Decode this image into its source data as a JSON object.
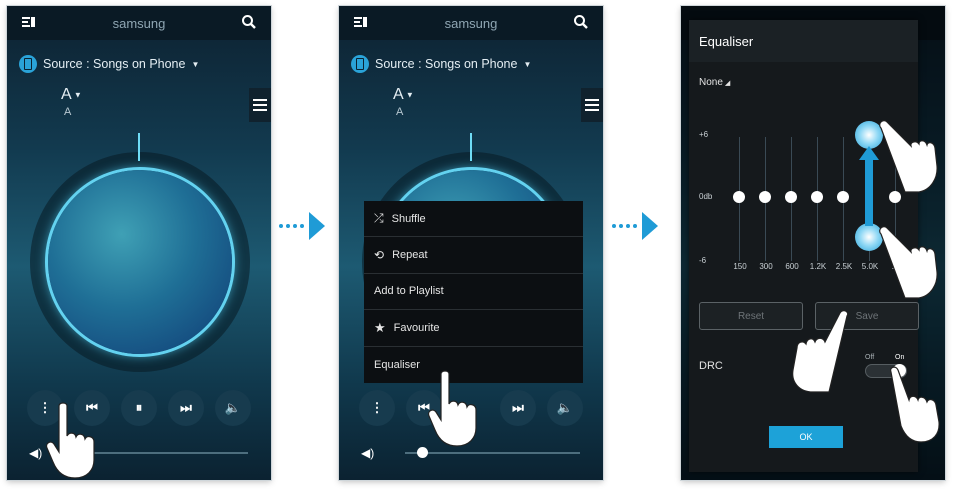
{
  "colors": {
    "accent": "#1f9bd6",
    "panel": "#0c0f12",
    "eq_bg": "#15191c"
  },
  "header": {
    "title": "samsung"
  },
  "player": {
    "source_label": "Source : Songs on Phone",
    "artist": "A",
    "album": "A"
  },
  "context_menu": {
    "items": [
      {
        "label": "Shuffle",
        "icon": "shuffle-icon"
      },
      {
        "label": "Repeat",
        "icon": "repeat-icon"
      },
      {
        "label": "Add to Playlist",
        "icon": ""
      },
      {
        "label": "Favourite",
        "icon": "star-icon"
      },
      {
        "label": "Equaliser",
        "icon": ""
      }
    ]
  },
  "equaliser": {
    "title": "Equaliser",
    "preset": "None",
    "y_labels": [
      "+6",
      "0db",
      "-6"
    ],
    "bands": [
      "150",
      "300",
      "600",
      "1.2K",
      "2.5K",
      "5.0K",
      "10"
    ],
    "reset_label": "Reset",
    "save_label": "Save",
    "drc_label": "DRC",
    "drc_off": "Off",
    "drc_on": "On",
    "ok_label": "OK"
  }
}
